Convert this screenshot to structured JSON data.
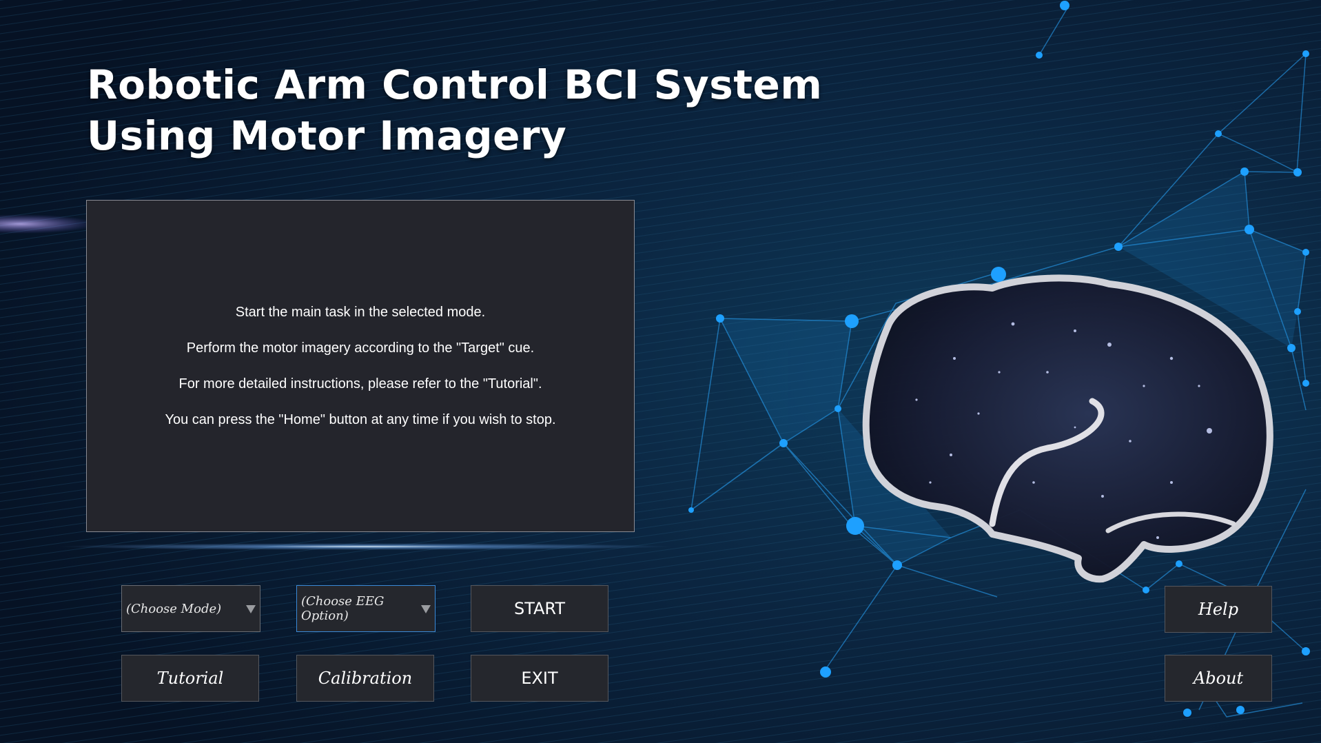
{
  "title": {
    "line1": "Robotic Arm Control BCI System",
    "line2": "Using Motor Imagery"
  },
  "instructions": [
    "Start the main task in the selected mode.",
    "Perform the motor imagery according to the \"Target\" cue.",
    "For more detailed instructions, please refer to the \"Tutorial\".",
    "You can press the \"Home\" button at any time if you wish to stop."
  ],
  "controls": {
    "mode_select": {
      "value": "(Choose Mode)"
    },
    "eeg_select": {
      "value": "(Choose EEG Option)"
    },
    "start_label": "START",
    "tutorial_label": "Tutorial",
    "calibration_label": "Calibration",
    "exit_label": "EXIT",
    "help_label": "Help",
    "about_label": "About"
  },
  "colors": {
    "background": "#0a1a2e",
    "panel": "#24252c",
    "button": "#25272d",
    "network_node": "#1ea0ff",
    "focus_border": "#3a8ad8"
  },
  "icons": {
    "dropdown": "chevron-down-icon",
    "brain": "brain-illustration"
  }
}
